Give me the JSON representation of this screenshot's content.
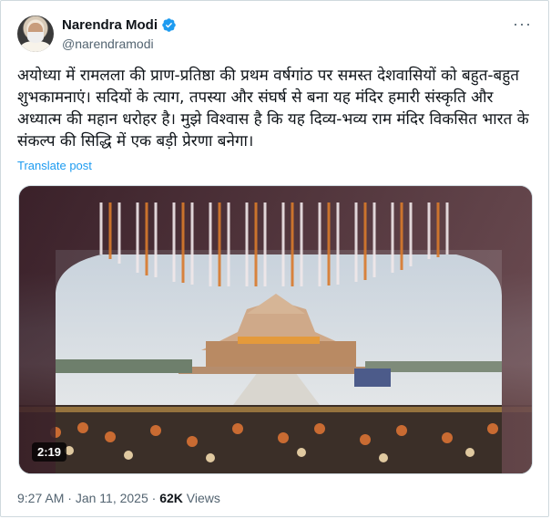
{
  "author": {
    "name": "Narendra Modi",
    "handle": "@narendramodi",
    "verified_icon": "verified-badge-icon"
  },
  "post": {
    "text": "अयोध्या में रामलला की प्राण-प्रतिष्ठा की प्रथम वर्षगांठ पर समस्त देशवासियों को बहुत-बहुत शुभकामनाएं। सदियों के त्याग, तपस्या और संघर्ष से बना यह मंदिर हमारी संस्कृति और अध्यात्म की महान धरोहर है। मुझे विश्वास है कि यह दिव्य-भव्य राम मंदिर विकसित भारत के संकल्प की सिद्धि में एक बड़ी प्रेरणा बनेगा।",
    "translate_label": "Translate post",
    "video_duration": "2:19",
    "time": "9:27 AM",
    "date": "Jan 11, 2025",
    "separator": " · ",
    "views_count": "62K",
    "views_label": " Views"
  },
  "colors": {
    "accent": "#1d9bf0",
    "secondary_text": "#536471",
    "primary_text": "#0f1419"
  }
}
